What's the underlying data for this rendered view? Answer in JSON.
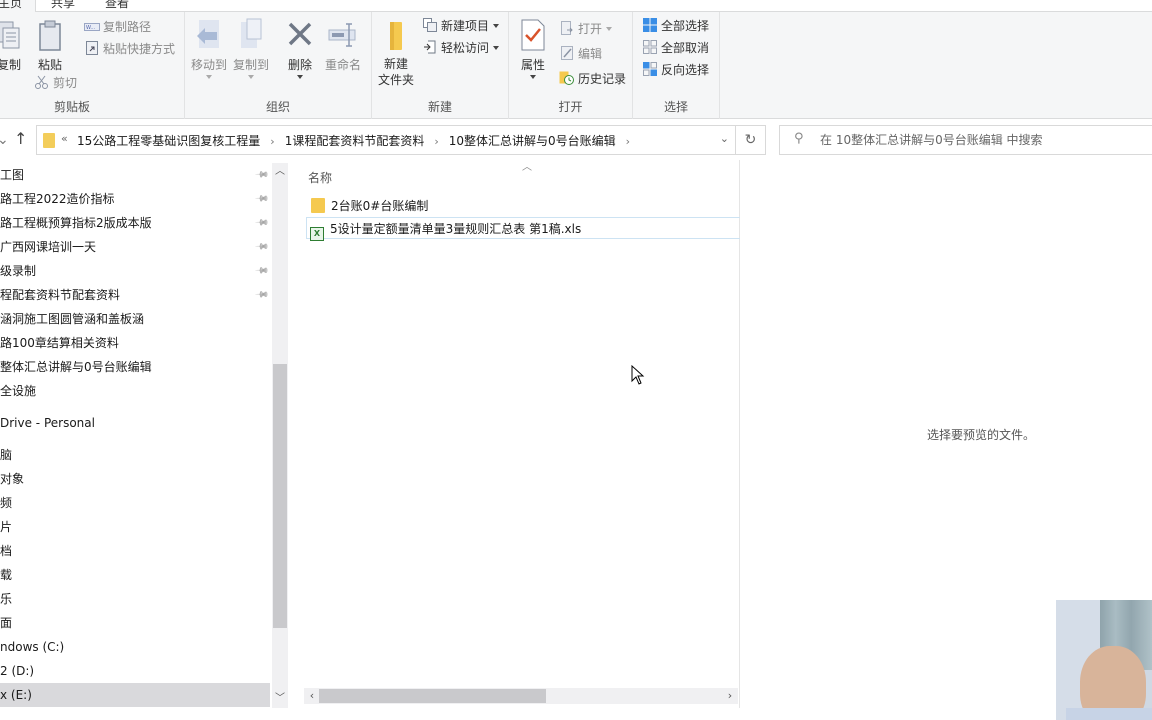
{
  "ribbon": {
    "tabs": [
      {
        "label": "主页",
        "active": true
      },
      {
        "label": "共享",
        "active": false
      },
      {
        "label": "查看",
        "active": false
      }
    ],
    "clipboard": {
      "label": "剪贴板",
      "copy": "复制",
      "paste": "粘贴",
      "copy_path": "复制路径",
      "paste_shortcut": "粘贴快捷方式",
      "cut": "剪切"
    },
    "organize": {
      "label": "组织",
      "move_to": "移动到",
      "copy_to": "复制到",
      "delete": "删除",
      "rename": "重命名"
    },
    "new": {
      "label": "新建",
      "new_folder_line1": "新建",
      "new_folder_line2": "文件夹",
      "new_item": "新建项目",
      "easy_access": "轻松访问"
    },
    "open": {
      "label": "打开",
      "properties": "属性",
      "open": "打开",
      "edit": "编辑",
      "history": "历史记录"
    },
    "select": {
      "label": "选择",
      "select_all": "全部选择",
      "select_none": "全部取消",
      "invert_selection": "反向选择"
    }
  },
  "navigation": {
    "back_icon": "chevron-down",
    "up_icon": "arrow-up",
    "overflow": "«",
    "breadcrumbs": [
      "15公路工程零基础识图复核工程量",
      "1课程配套资料节配套资料",
      "10整体汇总讲解与0号台账编辑"
    ],
    "refresh_icon": "↻",
    "search_placeholder": "在 10整体汇总讲解与0号台账编辑 中搜索"
  },
  "sidebar": {
    "items": [
      {
        "label": "工图",
        "pinned": true
      },
      {
        "label": "路工程2022造价指标",
        "pinned": true
      },
      {
        "label": "路工程概预算指标2版成本版",
        "pinned": true
      },
      {
        "label": "广西网课培训一天",
        "pinned": true
      },
      {
        "label": "级录制",
        "pinned": true
      },
      {
        "label": "程配套资料节配套资料",
        "pinned": true
      },
      {
        "label": "涵洞施工图圆管涵和盖板涵",
        "pinned": false
      },
      {
        "label": "路100章结算相关资料",
        "pinned": false
      },
      {
        "label": "整体汇总讲解与0号台账编辑",
        "pinned": false
      },
      {
        "label": "全设施",
        "pinned": false
      },
      {
        "label": "Drive - Personal",
        "pinned": false
      },
      {
        "label": "脑",
        "pinned": false
      },
      {
        "label": " 对象",
        "pinned": false
      },
      {
        "label": "频",
        "pinned": false
      },
      {
        "label": "片",
        "pinned": false
      },
      {
        "label": "档",
        "pinned": false
      },
      {
        "label": "载",
        "pinned": false
      },
      {
        "label": "乐",
        "pinned": false
      },
      {
        "label": "面",
        "pinned": false
      },
      {
        "label": "ndows (C:)",
        "pinned": false
      },
      {
        "label": "2 (D:)",
        "pinned": false
      },
      {
        "label": "x (E:)",
        "pinned": false,
        "selected": true
      }
    ],
    "scroll_position": 0.37
  },
  "filelist": {
    "column_name": "名称",
    "sort": "ascending",
    "files": [
      {
        "name": "2台账0#台账编制",
        "type": "folder"
      },
      {
        "name": "5设计量定额量清单量3量规则汇总表 第1稿.xls",
        "type": "xls"
      }
    ],
    "hscroll_position": 0
  },
  "preview": {
    "empty_text": "选择要预览的文件。"
  }
}
